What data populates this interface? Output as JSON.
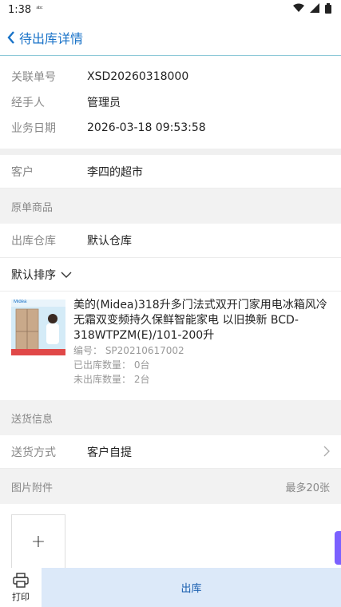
{
  "status_bar": {
    "time": "1:38",
    "indicator": "ᵃᵇᶜ"
  },
  "header": {
    "back_icon": "chevron-left",
    "title": "待出库详情"
  },
  "info": {
    "order_label": "关联单号",
    "order_value": "XSD20260318000",
    "handler_label": "经手人",
    "handler_value": "管理员",
    "date_label": "业务日期",
    "date_value": "2026-03-18 09:53:58"
  },
  "customer": {
    "label": "客户",
    "value": "李四的超市"
  },
  "original_goods": {
    "header": "原单商品"
  },
  "warehouse": {
    "label": "出库仓库",
    "value": "默认仓库"
  },
  "sort": {
    "label": "默认排序"
  },
  "product": {
    "name": "美的(Midea)318升多门法式双开门家用电冰箱风冷无霜双变频持久保鲜智能家电 以旧换新 BCD-318WTPZM(E)/101-200升",
    "code": "编号： SP20210617002",
    "shipped": "已出库数量： 0台",
    "unshipped": "未出库数量： 2台",
    "brand_mark": "Midea"
  },
  "delivery": {
    "header": "送货信息",
    "label": "送货方式",
    "value": "客户自提"
  },
  "attachments": {
    "header": "图片附件",
    "limit": "最多20张",
    "add_symbol": "+"
  },
  "bottom": {
    "print_label": "打印",
    "ship_label": "出库"
  },
  "colors": {
    "accent": "#1a73c8",
    "ship_bg": "#dce9f9",
    "side_tab": "#7b61ff"
  }
}
